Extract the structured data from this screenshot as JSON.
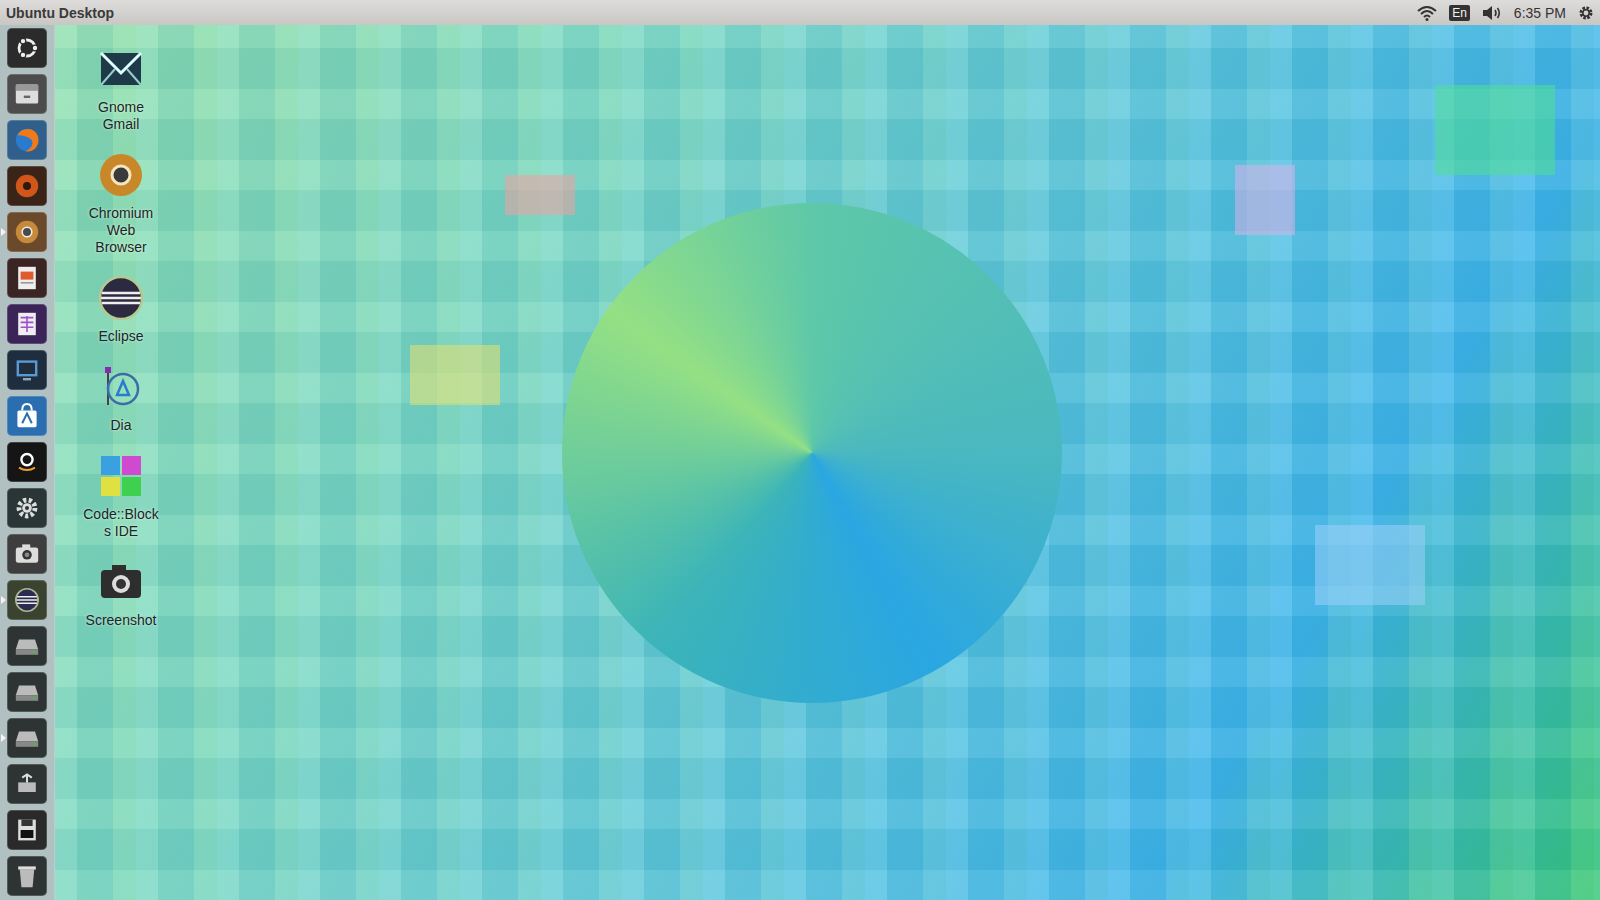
{
  "top_bar": {
    "title": "Ubuntu Desktop",
    "keyboard": "En",
    "clock": "6:35 PM"
  },
  "launcher": {
    "items": [
      {
        "running": false
      },
      {
        "running": false
      },
      {
        "running": false
      },
      {
        "running": false
      },
      {
        "running": true
      },
      {
        "running": false
      },
      {
        "running": false
      },
      {
        "running": false
      },
      {
        "running": false
      },
      {
        "running": false
      },
      {
        "running": false
      },
      {
        "running": false
      },
      {
        "running": true
      },
      {
        "running": false
      },
      {
        "running": false
      },
      {
        "running": true
      },
      {
        "running": false
      },
      {
        "running": false
      },
      {
        "running": false
      }
    ]
  },
  "desktop_icons": [
    {
      "label": "Gnome Gmail"
    },
    {
      "label": "Chromium Web Browser"
    },
    {
      "label": "Eclipse"
    },
    {
      "label": "Dia"
    },
    {
      "label": "Code::Blocks IDE"
    },
    {
      "label": "Screenshot"
    }
  ]
}
